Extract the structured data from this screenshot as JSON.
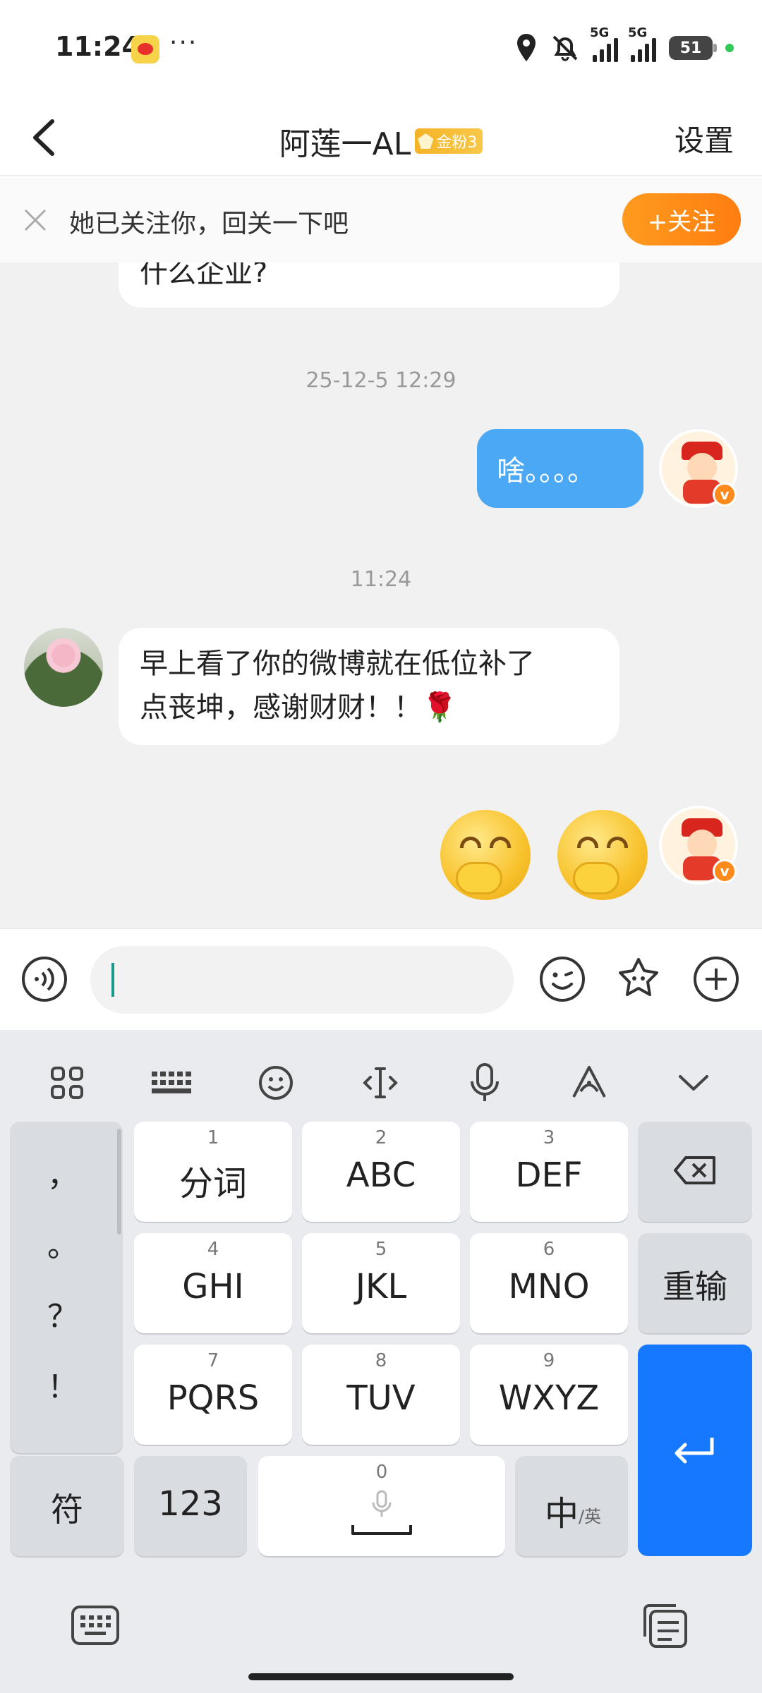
{
  "status_bar": {
    "time": "11:24",
    "more": "···",
    "network_1": "5G",
    "network_2": "5G",
    "battery": "51",
    "icons": [
      "weibo-icon",
      "location-icon",
      "mute-icon",
      "signal-icon",
      "signal-icon",
      "battery-icon"
    ]
  },
  "header": {
    "back_icon": "chevron-left-icon",
    "title": "阿莲一AL",
    "fan_badge": "金粉3",
    "settings_label": "设置"
  },
  "follow_banner": {
    "text": "她已关注你，回关一下吧",
    "button_label": "+关注",
    "close_icon": "close-icon"
  },
  "messages": {
    "partial_text": "什么企业?",
    "timestamp_1": "25-12-5 12:29",
    "my_message_1": "啥。。。。",
    "timestamp_2": "11:24",
    "their_message_line1": "早上看了你的微博就在低位补了",
    "their_message_line2": "点丧坤，感谢财财！！🌹",
    "my_stickers": [
      "thinking-emoji",
      "thinking-emoji"
    ],
    "verified_badge": "v"
  },
  "input_bar": {
    "voice_icon": "voice-icon",
    "emoji_icon": "smile-icon",
    "sticker_icon": "sticker-icon",
    "plus_icon": "plus-icon",
    "value": ""
  },
  "keyboard": {
    "toolbar": [
      "grid-icon",
      "keyboard-icon",
      "emoji-icon",
      "cursor-icon",
      "mic-icon",
      "handwriting-icon",
      "chevron-down-icon"
    ],
    "side_punct": [
      "，",
      "。",
      "？",
      "！"
    ],
    "keys": [
      {
        "num": "1",
        "label": "分词"
      },
      {
        "num": "2",
        "label": "ABC"
      },
      {
        "num": "3",
        "label": "DEF"
      },
      {
        "num": "4",
        "label": "GHI"
      },
      {
        "num": "5",
        "label": "JKL"
      },
      {
        "num": "6",
        "label": "MNO"
      },
      {
        "num": "7",
        "label": "PQRS"
      },
      {
        "num": "8",
        "label": "TUV"
      },
      {
        "num": "9",
        "label": "WXYZ"
      }
    ],
    "reenter_label": "重输",
    "symbol_label": "符",
    "num_label": "123",
    "space_num": "0",
    "lang_main": "中",
    "lang_sub": "/英"
  },
  "colors": {
    "accent_blue": "#4aa8f5",
    "follow_orange": "#ff8a1c",
    "enter_blue": "#1677ff"
  }
}
